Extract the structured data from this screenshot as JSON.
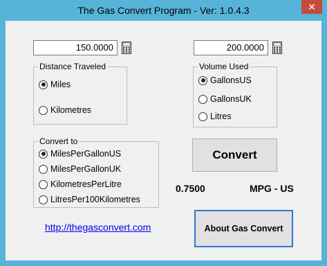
{
  "window": {
    "title": "The Gas Convert Program - Ver: 1.0.4.3",
    "close_label": "✕"
  },
  "inputs": {
    "distance_value": "150.0000",
    "volume_value": "200.0000"
  },
  "distance_group": {
    "legend": "Distance Traveled",
    "options": [
      {
        "label": "Miles",
        "checked": true
      },
      {
        "label": "Kilometres",
        "checked": false
      }
    ]
  },
  "volume_group": {
    "legend": "Volume Used",
    "options": [
      {
        "label": "GallonsUS",
        "checked": true
      },
      {
        "label": "GallonsUK",
        "checked": false
      },
      {
        "label": "Litres",
        "checked": false
      }
    ]
  },
  "convert_group": {
    "legend": "Convert to",
    "options": [
      {
        "label": "MilesPerGallonUS",
        "checked": true
      },
      {
        "label": "MilesPerGallonUK",
        "checked": false
      },
      {
        "label": "KilometresPerLitre",
        "checked": false
      },
      {
        "label": "LitresPer100Kilometres",
        "checked": false
      }
    ]
  },
  "convert_button": "Convert",
  "result": {
    "value": "0.7500",
    "unit": "MPG - US"
  },
  "link_text": "http://thegasconvert.com",
  "about_button": "About Gas Convert",
  "colors": {
    "title_bar": "#57b4d8",
    "close_button": "#c74a3a",
    "focus_border": "#2b78d4",
    "link": "#0000ee"
  }
}
